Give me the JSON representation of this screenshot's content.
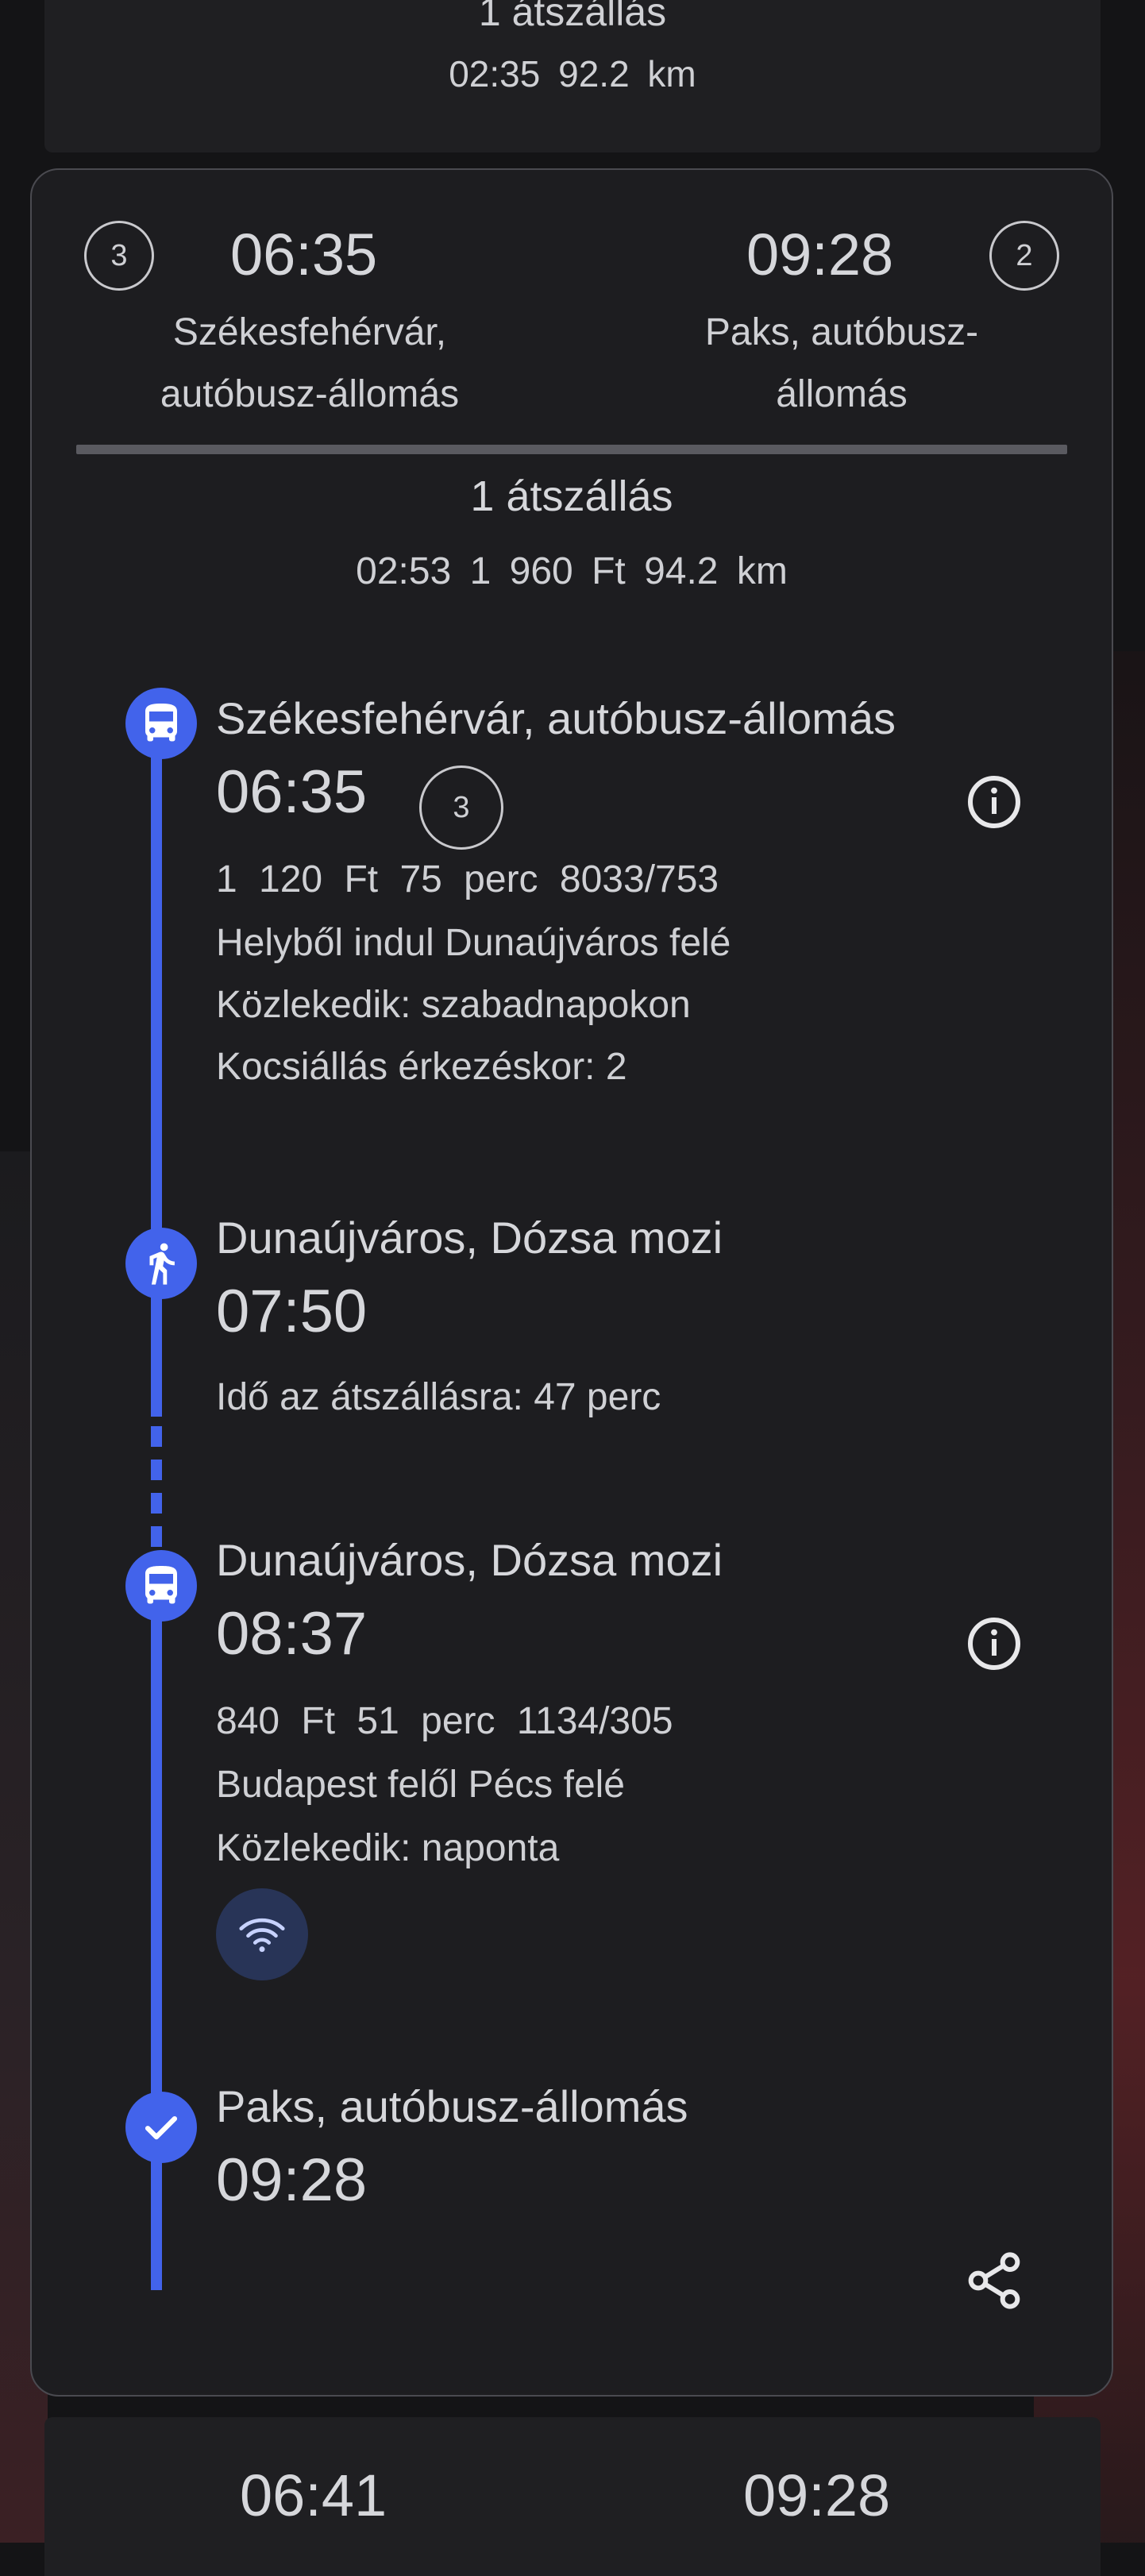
{
  "prev_card": {
    "transfers": "1 átszállás",
    "duration": "02:35",
    "distance": "92.2 km"
  },
  "card": {
    "departure": {
      "badge": "3",
      "time": "06:35",
      "place": "Székesfehérvár, autóbusz-állomás"
    },
    "arrival": {
      "badge": "2",
      "time": "09:28",
      "place": "Paks, autóbusz-állomás"
    },
    "summary": {
      "transfers": "1 átszállás",
      "duration": "02:53",
      "price": "1 960 Ft",
      "distance": "94.2 km"
    },
    "legs": [
      {
        "icon": "bus-icon",
        "stop": "Székesfehérvár, autóbusz-állomás",
        "time": "06:35",
        "platform_badge": "3",
        "price": "1 120 Ft",
        "duration": "75 perc",
        "route": "8033/753",
        "direction": "Helyből indul Dunaújváros felé",
        "runs": "Közlekedik: szabadnapokon",
        "stand": "Kocsiállás érkezéskor: 2"
      },
      {
        "icon": "walk-icon",
        "stop": "Dunaújváros, Dózsa mozi",
        "time": "07:50",
        "transfer_time": "Idő az átszállásra: 47 perc"
      },
      {
        "icon": "bus-icon",
        "stop": "Dunaújváros, Dózsa mozi",
        "time": "08:37",
        "price": "840 Ft",
        "duration": "51 perc",
        "route": "1134/305",
        "direction": "Budapest felől Pécs felé",
        "runs": "Közlekedik: naponta",
        "amenity": "wifi-icon"
      },
      {
        "icon": "check-icon",
        "stop": "Paks, autóbusz-állomás",
        "time": "09:28"
      }
    ]
  },
  "next_card": {
    "departure_time": "06:41",
    "arrival_time": "09:28"
  },
  "colors": {
    "accent": "#4263eb",
    "card_bg": "#1d1d20",
    "text": "#cfd0d4"
  }
}
